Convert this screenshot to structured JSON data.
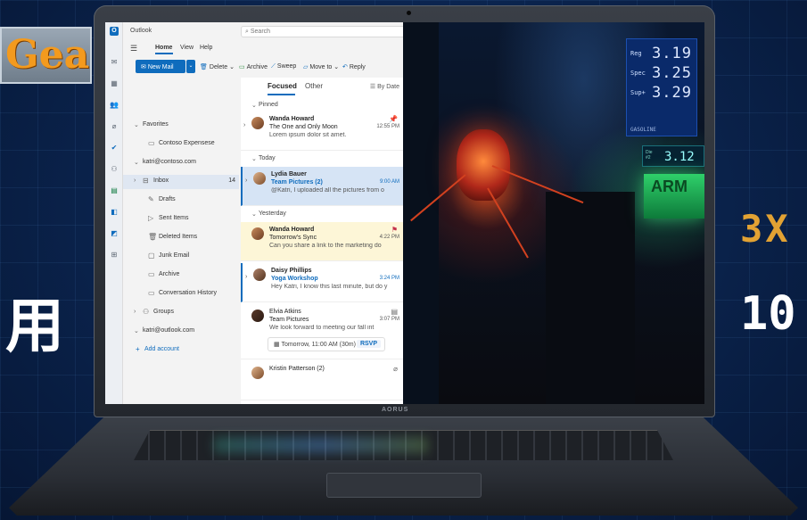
{
  "promo": {
    "left_top": "Gear",
    "left_bottom": "用",
    "right_top": "3X",
    "right_bottom": "10"
  },
  "laptop": {
    "brand": "AORUS"
  },
  "outlook": {
    "app_name": "Outlook",
    "search_placeholder": "Search",
    "menu": [
      "Home",
      "View",
      "Help"
    ],
    "ribbon": {
      "new_mail": "New Mail",
      "delete": "Delete",
      "archive": "Archive",
      "sweep": "Sweep",
      "move_to": "Move to",
      "reply": "Reply"
    },
    "folders": {
      "favorites": "Favorites",
      "contoso_expenses": "Contoso Expensese",
      "account1": "katri@contoso.com",
      "inbox": "Inbox",
      "inbox_count": "14",
      "drafts": "Drafts",
      "sent": "Sent Items",
      "deleted": "Deleted Items",
      "junk": "Junk Email",
      "archive": "Archive",
      "conversation_history": "Conversation History",
      "groups": "Groups",
      "account2": "katri@outlook.com",
      "add_account": "Add account"
    },
    "list": {
      "tab_focused": "Focused",
      "tab_other": "Other",
      "sort": "By Date",
      "group_pinned": "Pinned",
      "group_today": "Today",
      "group_yesterday": "Yesterday",
      "messages": [
        {
          "sender": "Wanda Howard",
          "subject": "The One and Only Moon",
          "preview": "Lorem ipsum dolor sit amet.",
          "time": "12:55 PM"
        },
        {
          "sender": "Lydia Bauer",
          "subject": "Team Pictures  (2)",
          "preview": "@Katri, I uploaded all the pictures from o",
          "time": "9:00 AM"
        },
        {
          "sender": "Wanda Howard",
          "subject": "Tomorrow's Sync",
          "preview": "Can you share a link to the marketing do",
          "time": "4:22 PM"
        },
        {
          "sender": "Daisy Phillips",
          "subject": "Yoga Workshop",
          "preview": "Hey Katri, I know this last minute, but do y",
          "time": "3:24 PM"
        },
        {
          "sender": "Elvia Atkins",
          "subject": "Team Pictures",
          "preview": "We look forward to meeting our fall int",
          "time": "3:07 PM",
          "event": "Tomorrow, 11:00 AM (30m)",
          "rsvp": "RSVP"
        },
        {
          "sender": "Kristin Patterson (2)"
        }
      ]
    }
  },
  "game": {
    "sign_rows": [
      {
        "k": "Reg",
        "v": "3.19"
      },
      {
        "k": "Spec",
        "v": "3.25"
      },
      {
        "k": "Sup+",
        "v": "3.29"
      }
    ],
    "sign_label": "GASOLINE",
    "sign2_key": "Die\n#2",
    "sign2_value": "3.12",
    "panel_text": "ARM"
  }
}
